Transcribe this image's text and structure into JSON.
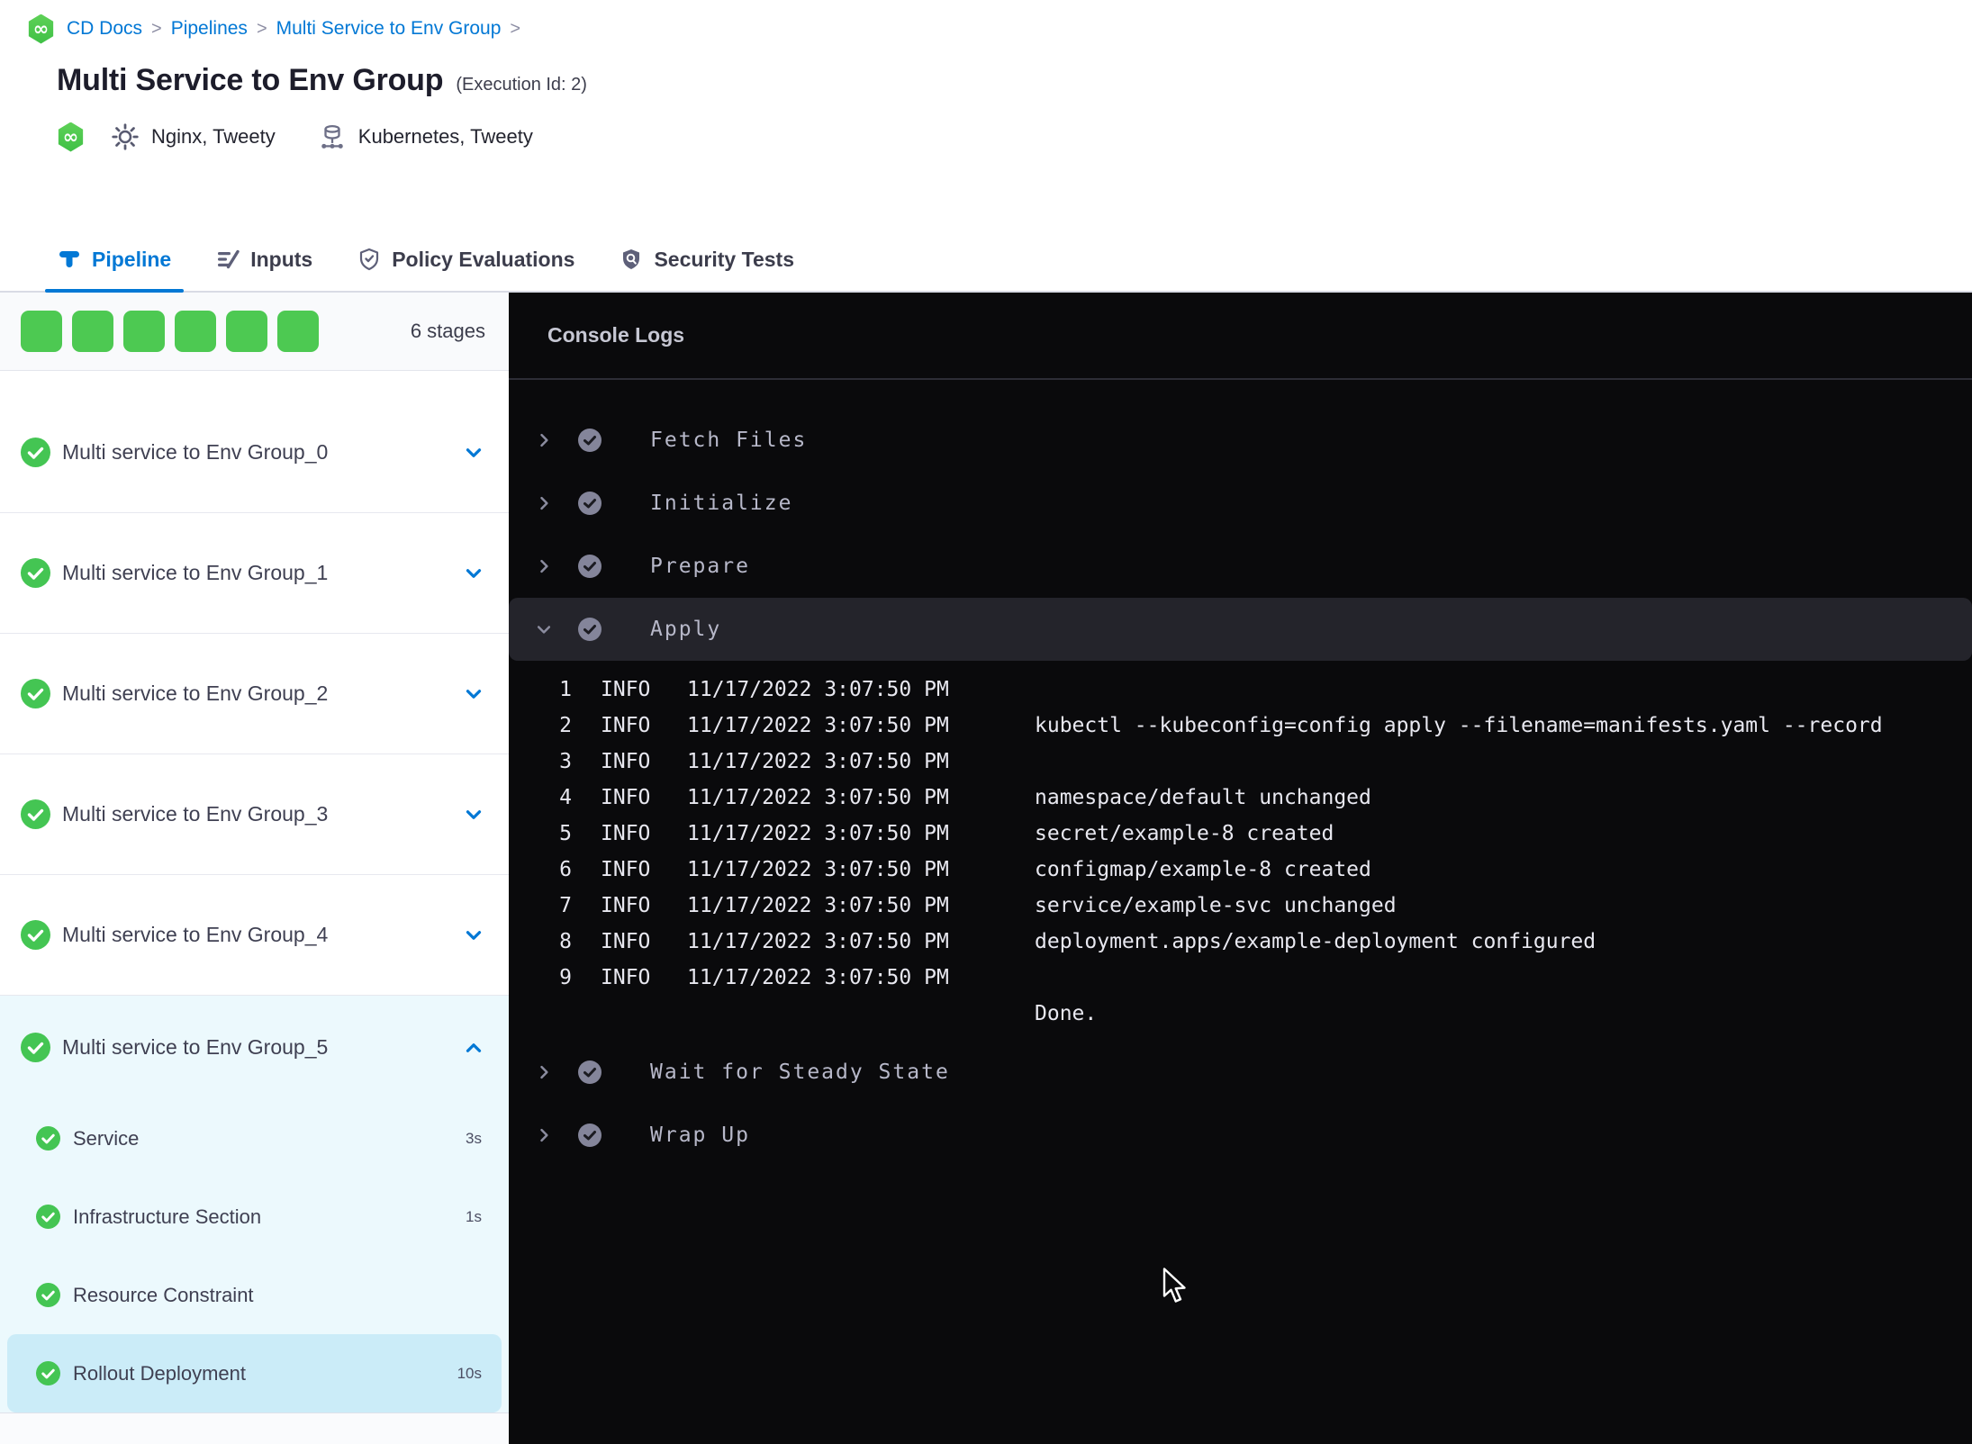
{
  "breadcrumb": {
    "items": [
      "CD Docs",
      "Pipelines",
      "Multi Service to Env Group"
    ],
    "separator": ">",
    "module_icon": "cd-module-icon"
  },
  "header": {
    "title": "Multi Service to Env Group",
    "execution_id_label": "(Execution Id: 2)",
    "module_icon": "cd-module-icon",
    "services_icon": "gear-icon",
    "services_label": "Nginx, Tweety",
    "environments_icon": "environments-icon",
    "environments_label": "Kubernetes, Tweety"
  },
  "tabs": [
    {
      "label": "Pipeline",
      "icon": "pipeline-icon",
      "active": true
    },
    {
      "label": "Inputs",
      "icon": "inputs-icon",
      "active": false
    },
    {
      "label": "Policy Evaluations",
      "icon": "policy-evaluations-icon",
      "active": false
    },
    {
      "label": "Security Tests",
      "icon": "security-tests-icon",
      "active": false
    }
  ],
  "sidebar": {
    "progress_squares": 6,
    "stage_count_label": "6 stages",
    "stages": [
      {
        "label": "Multi service to Env Group_0",
        "status": "success",
        "expanded": false
      },
      {
        "label": "Multi service to Env Group_1",
        "status": "success",
        "expanded": false
      },
      {
        "label": "Multi service to Env Group_2",
        "status": "success",
        "expanded": false
      },
      {
        "label": "Multi service to Env Group_3",
        "status": "success",
        "expanded": false
      },
      {
        "label": "Multi service to Env Group_4",
        "status": "success",
        "expanded": false
      },
      {
        "label": "Multi service to Env Group_5",
        "status": "success",
        "expanded": true,
        "steps": [
          {
            "label": "Service",
            "duration": "3s",
            "status": "success",
            "selected": false
          },
          {
            "label": "Infrastructure Section",
            "duration": "1s",
            "status": "success",
            "selected": false
          },
          {
            "label": "Resource Constraint",
            "duration": "",
            "status": "success",
            "selected": false
          },
          {
            "label": "Rollout Deployment",
            "duration": "10s",
            "status": "success",
            "selected": true
          }
        ]
      }
    ]
  },
  "console": {
    "title": "Console Logs",
    "sections": [
      {
        "label": "Fetch Files",
        "status": "success",
        "expanded": false
      },
      {
        "label": "Initialize",
        "status": "success",
        "expanded": false
      },
      {
        "label": "Prepare",
        "status": "success",
        "expanded": false
      },
      {
        "label": "Apply",
        "status": "success",
        "expanded": true,
        "logs": [
          {
            "num": "1",
            "level": "INFO",
            "time": "11/17/2022 3:07:50 PM",
            "message": ""
          },
          {
            "num": "2",
            "level": "INFO",
            "time": "11/17/2022 3:07:50 PM",
            "message": "kubectl --kubeconfig=config apply --filename=manifests.yaml --record"
          },
          {
            "num": "3",
            "level": "INFO",
            "time": "11/17/2022 3:07:50 PM",
            "message": ""
          },
          {
            "num": "4",
            "level": "INFO",
            "time": "11/17/2022 3:07:50 PM",
            "message": "namespace/default unchanged"
          },
          {
            "num": "5",
            "level": "INFO",
            "time": "11/17/2022 3:07:50 PM",
            "message": "secret/example-8 created"
          },
          {
            "num": "6",
            "level": "INFO",
            "time": "11/17/2022 3:07:50 PM",
            "message": "configmap/example-8 created"
          },
          {
            "num": "7",
            "level": "INFO",
            "time": "11/17/2022 3:07:50 PM",
            "message": "service/example-svc unchanged"
          },
          {
            "num": "8",
            "level": "INFO",
            "time": "11/17/2022 3:07:50 PM",
            "message": "deployment.apps/example-deployment configured"
          },
          {
            "num": "9",
            "level": "INFO",
            "time": "11/17/2022 3:07:50 PM",
            "message": ""
          },
          {
            "num": "",
            "level": "",
            "time": "",
            "message": "Done."
          }
        ]
      },
      {
        "label": "Wait for Steady State",
        "status": "success",
        "expanded": false
      },
      {
        "label": "Wrap Up",
        "status": "success",
        "expanded": false
      }
    ]
  },
  "colors": {
    "accent_blue": "#0278d5",
    "success_green": "#4dc952",
    "console_background": "#0a0a0c",
    "console_highlight_row": "#24242b",
    "selected_step_background": "#cbecf8",
    "expanded_stage_background": "#ecf9fd"
  }
}
